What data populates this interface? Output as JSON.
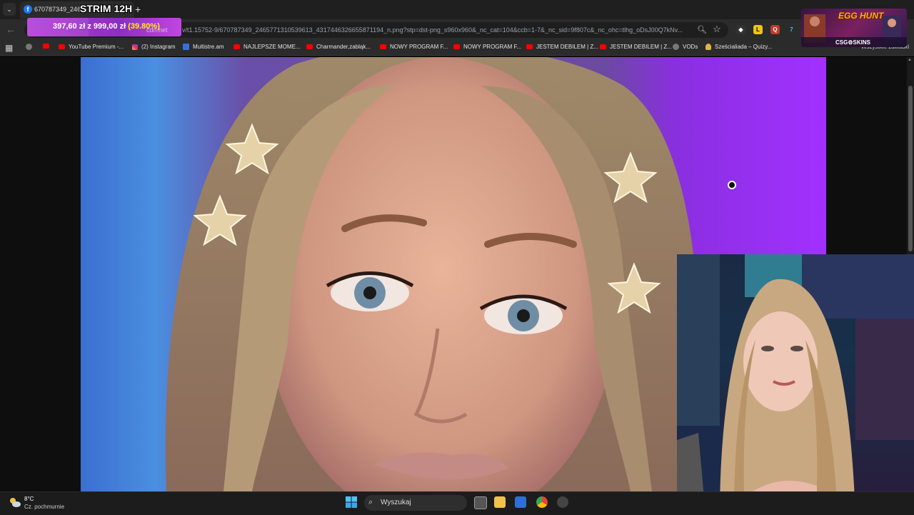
{
  "colors": {
    "accent": "#b53fd8",
    "progress_pct": "#fff200",
    "tab_bg": "#1f1f1f",
    "toolbar_bg": "#2b2b2b"
  },
  "tabs": {
    "active": {
      "title": "670787349_24657",
      "icon": "facebook-icon"
    },
    "new_tab_icon": "+"
  },
  "stream_overlay": {
    "title": "STRIM 12H",
    "donation": {
      "amount": "397,60 zł",
      "connector": "z",
      "goal": "999,00 zł",
      "percent": "(39.80%)",
      "progress": 0.398
    },
    "widget": {
      "title": "EGG HUNT",
      "sponsor": "CSG⚙SKINS"
    }
  },
  "address_bar": {
    "domain_tail": "cdn.net",
    "url": "v/t1.15752-9/670787349_2465771310539613_4317446326655871194_n.png?stp=dst-png_s960x960&_nc_cat=104&ccb=1-7&_nc_sid=9f807c&_nc_ohc=tlhg_oDsJ00Q7kNv..."
  },
  "bookmarks": [
    {
      "label": "",
      "icon": "youtube"
    },
    {
      "label": "YouTube Premium -...",
      "icon": "youtube"
    },
    {
      "label": "(2) Instagram",
      "icon": "instagram"
    },
    {
      "label": "Multistre.am",
      "icon": "multistream"
    },
    {
      "label": "NAJLEPSZE MOME...",
      "icon": "youtube"
    },
    {
      "label": "Charmander,zabląk...",
      "icon": "youtube"
    },
    {
      "label": "NOWY PROGRAM F...",
      "icon": "youtube"
    },
    {
      "label": "NOWY PROGRAM F...",
      "icon": "youtube"
    },
    {
      "label": "JESTEM DEBILEM | Z...",
      "icon": "youtube"
    },
    {
      "label": "JESTEM DEBILEM | Z...",
      "icon": "youtube"
    },
    {
      "label": "VODs",
      "icon": "vods"
    },
    {
      "label": "Sześcialiada – Quizy...",
      "icon": "quiz"
    }
  ],
  "bookmarks_all": "Wszystkie zakładki",
  "taskbar": {
    "weather": {
      "temp": "8°C",
      "desc": "Cz. pochmurnie"
    },
    "search_label": "Wyszukaj"
  }
}
